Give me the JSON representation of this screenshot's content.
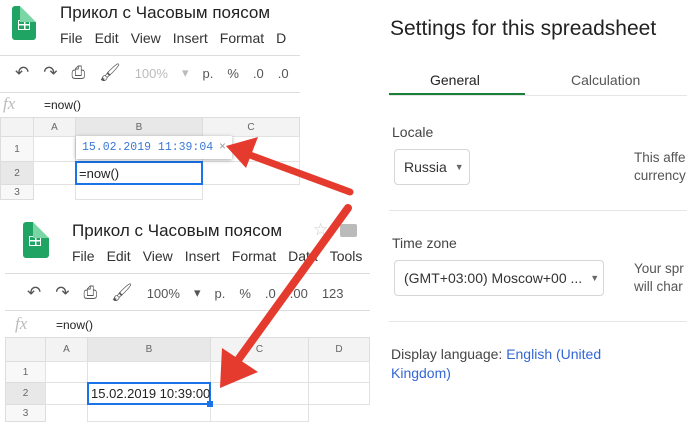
{
  "top_snippet": {
    "title": "Прикол с Часовым поясом",
    "menu": [
      "File",
      "Edit",
      "View",
      "Insert",
      "Format",
      "D"
    ],
    "toolbar": {
      "zoom": "100%",
      "currency": "р.",
      "percent": "%",
      "dec": ".0",
      "dec2": ".0"
    },
    "formula": "=now()",
    "columns": [
      "A",
      "B",
      "C"
    ],
    "rows": [
      "1",
      "2",
      "3"
    ],
    "cell_b2": "=now()",
    "tooltip_value": "15.02.2019 11:39:04",
    "tooltip_close": "×"
  },
  "bottom_snippet": {
    "title": "Прикол с Часовым поясом",
    "menu": [
      "File",
      "Edit",
      "View",
      "Insert",
      "Format",
      "Data",
      "Tools"
    ],
    "toolbar": {
      "zoom": "100%",
      "currency": "р.",
      "percent": "%",
      "dec": ".0",
      "dec2": ".00",
      "format": "123"
    },
    "formula": "=now()",
    "columns": [
      "A",
      "B",
      "C",
      "D"
    ],
    "rows": [
      "1",
      "2",
      "3"
    ],
    "cell_b2": "15.02.2019 10:39:00"
  },
  "settings": {
    "title": "Settings for this spreadsheet",
    "tabs": [
      {
        "label": "General",
        "active": true
      },
      {
        "label": "Calculation",
        "active": false
      }
    ],
    "locale_label": "Locale",
    "locale_value": "Russia",
    "locale_desc": [
      "This affe",
      "currency"
    ],
    "timezone_label": "Time zone",
    "timezone_value": "(GMT+03:00) Moscow+00 ...",
    "timezone_desc": [
      "Your spr",
      "will char"
    ],
    "display_language_label": "Display language:",
    "display_language_value": "English (United Kingdom)"
  },
  "colors": {
    "accent": "#188038",
    "arrow": "#e53b2f",
    "link": "#3367d6",
    "selection": "#1a73e8"
  }
}
